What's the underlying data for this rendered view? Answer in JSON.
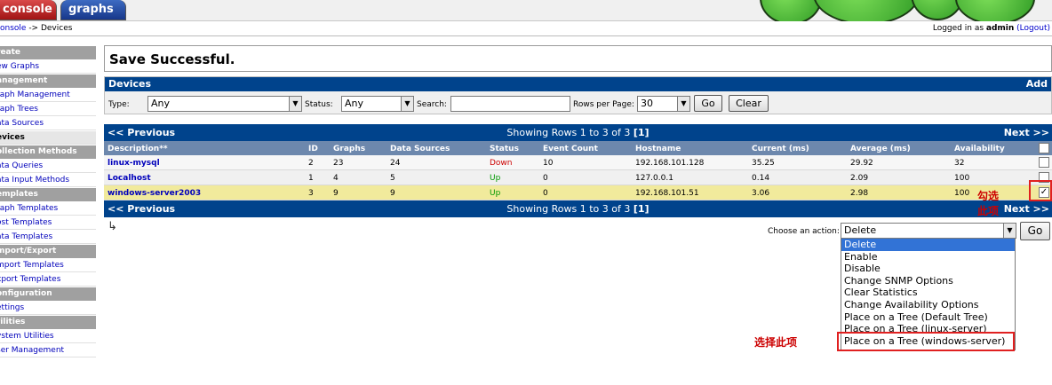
{
  "tabs": {
    "console": "console",
    "graphs": "graphs"
  },
  "breadcrumb": {
    "link": "onsole",
    "separator": " -> ",
    "current": "Devices"
  },
  "login": {
    "prefix": "Logged in as ",
    "user": "admin",
    "logout": "(Logout)"
  },
  "sidebar": [
    {
      "type": "head",
      "label": "reate"
    },
    {
      "type": "item",
      "label": "ew Graphs"
    },
    {
      "type": "head",
      "label": "anagement"
    },
    {
      "type": "item",
      "label": "raph Management"
    },
    {
      "type": "item",
      "label": "raph Trees"
    },
    {
      "type": "item",
      "label": "ata Sources"
    },
    {
      "type": "item",
      "label": "evices",
      "active": true
    },
    {
      "type": "head",
      "label": "ollection Methods"
    },
    {
      "type": "item",
      "label": "ata Queries"
    },
    {
      "type": "item",
      "label": "ata Input Methods"
    },
    {
      "type": "head",
      "label": "emplates"
    },
    {
      "type": "item",
      "label": "raph Templates"
    },
    {
      "type": "item",
      "label": "ost Templates"
    },
    {
      "type": "item",
      "label": "ata Templates"
    },
    {
      "type": "head",
      "label": "mport/Export"
    },
    {
      "type": "item",
      "label": "mport Templates"
    },
    {
      "type": "item",
      "label": "xport Templates"
    },
    {
      "type": "head",
      "label": "onfiguration"
    },
    {
      "type": "item",
      "label": "ettings"
    },
    {
      "type": "head",
      "label": "tilities"
    },
    {
      "type": "item",
      "label": "ystem Utilities"
    },
    {
      "type": "item",
      "label": "ser Management"
    }
  ],
  "message": "Save Successful.",
  "devices": {
    "title": "Devices",
    "add": "Add",
    "type_label": "Type:",
    "type_value": "Any",
    "status_label": "Status:",
    "status_value": "Any",
    "search_label": "Search:",
    "search_value": "",
    "rows_label": "Rows per Page:",
    "rows_value": "30",
    "go": "Go",
    "clear": "Clear"
  },
  "nav": {
    "prev": "<< Previous",
    "showing_prefix": "Showing Rows 1 to 3 of 3 ",
    "showing_page": "[1]",
    "next": "Next >>"
  },
  "columns": [
    "Description**",
    "ID",
    "Graphs",
    "Data Sources",
    "Status",
    "Event Count",
    "Hostname",
    "Current (ms)",
    "Average (ms)",
    "Availability"
  ],
  "rows": [
    {
      "description": "linux-mysql",
      "id": "2",
      "graphs": "23",
      "data_sources": "24",
      "status": "Down",
      "event_count": "10",
      "hostname": "192.168.101.128",
      "current": "35.25",
      "average": "29.92",
      "availability": "32",
      "checked": false
    },
    {
      "description": "Localhost",
      "id": "1",
      "graphs": "4",
      "data_sources": "5",
      "status": "Up",
      "event_count": "0",
      "hostname": "127.0.0.1",
      "current": "0.14",
      "average": "2.09",
      "availability": "100",
      "checked": false
    },
    {
      "description": "windows-server2003",
      "id": "3",
      "graphs": "9",
      "data_sources": "9",
      "status": "Up",
      "event_count": "0",
      "hostname": "192.168.101.51",
      "current": "3.06",
      "average": "2.98",
      "availability": "100",
      "checked": true
    }
  ],
  "annotations": {
    "check": "勾选此项",
    "select": "选择此项"
  },
  "action": {
    "label": "Choose an action:",
    "value": "Delete",
    "go": "Go",
    "options": [
      "Delete",
      "Enable",
      "Disable",
      "Change SNMP Options",
      "Clear Statistics",
      "Change Availability Options",
      "Place on a Tree (Default Tree)",
      "Place on a Tree (linux-server)",
      "Place on a Tree (windows-server)"
    ]
  },
  "colors": {
    "nav": "#00438c",
    "header": "#6d88ad",
    "selected_row": "#f1ea9c",
    "highlight": "#3273d6",
    "annotation": "#cc0000"
  }
}
